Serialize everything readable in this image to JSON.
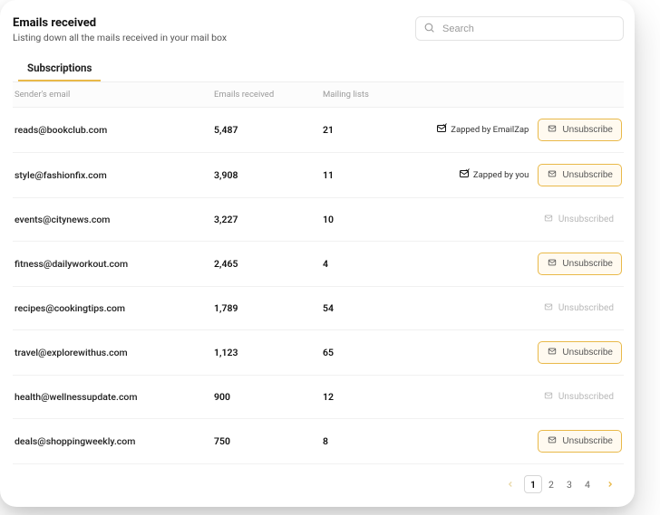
{
  "header": {
    "title": "Emails received",
    "subtitle": "Listing down all the mails received in your mail box"
  },
  "search": {
    "placeholder": "Search",
    "value": ""
  },
  "tabs": {
    "active": "Subscriptions"
  },
  "columns": {
    "sender": "Sender's email",
    "emails": "Emails received",
    "lists": "Mailing lists"
  },
  "labels": {
    "zapped_emailzap": "Zapped by EmailZap",
    "zapped_you": "Zapped by you",
    "unsubscribe": "Unsubscribe",
    "unsubscribed": "Unsubscribed"
  },
  "rows": [
    {
      "email": "reads@bookclub.com",
      "count": "5,487",
      "lists": "21",
      "zapped": "emailzap",
      "state": "unsubscribe"
    },
    {
      "email": "style@fashionfix.com",
      "count": "3,908",
      "lists": "11",
      "zapped": "you",
      "state": "unsubscribe"
    },
    {
      "email": "events@citynews.com",
      "count": "3,227",
      "lists": "10",
      "zapped": null,
      "state": "unsubscribed"
    },
    {
      "email": "fitness@dailyworkout.com",
      "count": "2,465",
      "lists": "4",
      "zapped": null,
      "state": "unsubscribe"
    },
    {
      "email": "recipes@cookingtips.com",
      "count": "1,789",
      "lists": "54",
      "zapped": null,
      "state": "unsubscribed"
    },
    {
      "email": "travel@explorewithus.com",
      "count": "1,123",
      "lists": "65",
      "zapped": null,
      "state": "unsubscribe"
    },
    {
      "email": "health@wellnessupdate.com",
      "count": "900",
      "lists": "12",
      "zapped": null,
      "state": "unsubscribed"
    },
    {
      "email": "deals@shoppingweekly.com",
      "count": "750",
      "lists": "8",
      "zapped": null,
      "state": "unsubscribe"
    }
  ],
  "pagination": {
    "pages": [
      "1",
      "2",
      "3",
      "4"
    ],
    "current": "1"
  }
}
